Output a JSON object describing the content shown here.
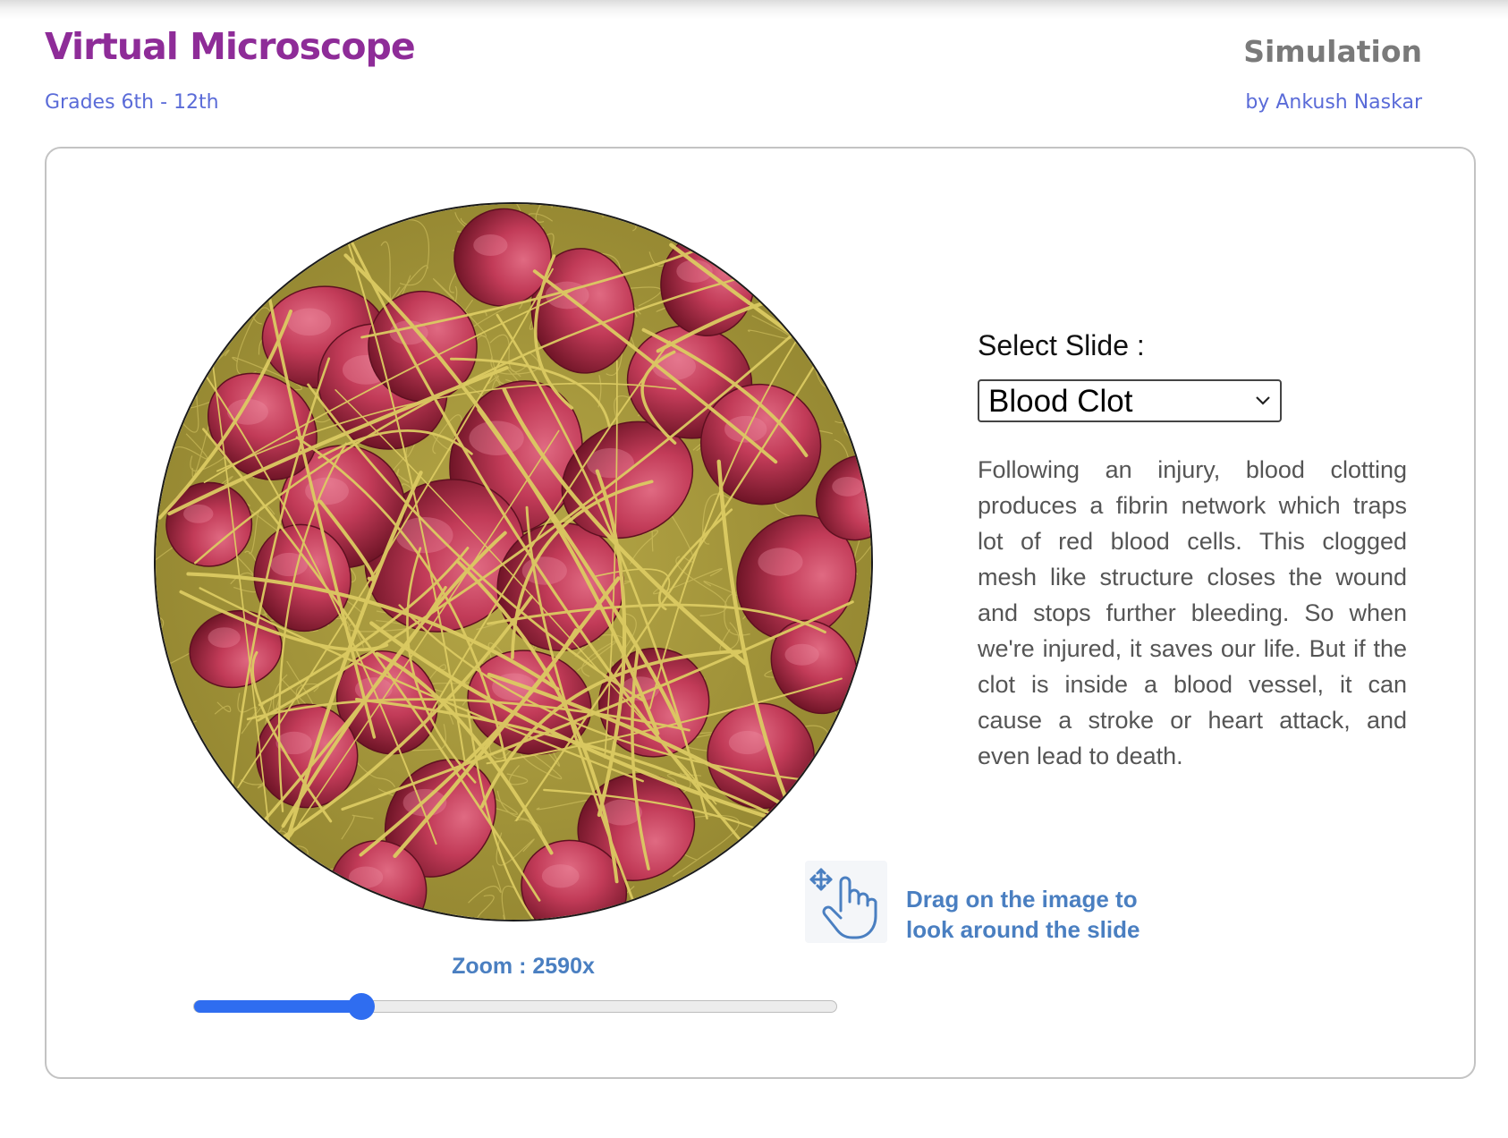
{
  "header": {
    "app_title": "Virtual Microscope",
    "grade_range": "Grades 6th - 12th",
    "type_label": "Simulation",
    "author": "by Ankush Naskar"
  },
  "microscope": {
    "slide_image": "blood-clot-sem-micrograph",
    "zoom_label": "Zoom : 2590x",
    "zoom_fraction": 0.26
  },
  "slide_selector": {
    "label": "Select Slide :",
    "selected": "Blood Clot",
    "icon": "chevron-down-icon"
  },
  "description": "Following an injury, blood clotting produces a fibrin network which traps lot of red blood cells. This clogged mesh like structure closes the wound and stops further bleeding. So when we're injured, it saves our life. But if the clot is inside a blood vessel, it can cause a stroke or heart attack, and even lead to death.",
  "drag_hint": {
    "icon": "drag-hand-icon",
    "line1": "Drag on the image to",
    "line2": "look around the slide"
  },
  "colors": {
    "title": "#8e2c98",
    "subtitle": "#5a6bd8",
    "accent": "#2f6df0",
    "hint": "#4a7fc1",
    "rbc": "#b8324e",
    "fibrin": "#c8b64a",
    "background_mesh": "#a89a3a"
  }
}
